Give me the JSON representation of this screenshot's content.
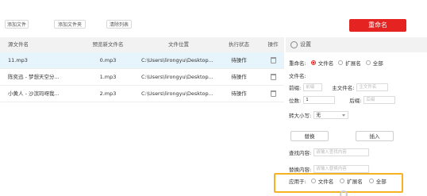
{
  "toolbar": {
    "add_file": "添加文件",
    "add_folder": "添加文件夹",
    "clear_list": "清除列表",
    "rename": "重命名"
  },
  "table": {
    "headers": [
      "源文件名",
      "预览新文件名",
      "文件位置",
      "执行状态",
      "操作"
    ],
    "rows": [
      {
        "source": "11.mp3",
        "preview": "0.mp3",
        "location": "C:\\Users\\lirongyu\\Desktop...",
        "status": "待操作"
      },
      {
        "source": "陈奕迅 - 梦想天空分...",
        "preview": "1.mp3",
        "location": "C:\\Users\\lirongyu\\Desktop...",
        "status": "待操作"
      },
      {
        "source": "小黄人 - 沙滨玛呀我...",
        "preview": "2.mp3",
        "location": "C:\\Users\\lirongyu\\Desktop...",
        "status": "待操作"
      }
    ]
  },
  "panel": {
    "title": "设置",
    "rename_label": "重命名:",
    "opt_filename": "文件名",
    "opt_ext": "扩展名",
    "opt_all": "全部",
    "filename_label": "文件名:",
    "prefix_label": "前缀:",
    "prefix_placeholder": "前缀",
    "main_label": "主文件名:",
    "main_placeholder": "主文件名",
    "digits_label": "位数:",
    "digits_value": "1",
    "suffix_label": "后缀:",
    "suffix_placeholder": "后缀",
    "case_label": "转大小写:",
    "case_value": "无",
    "replace_btn": "替换",
    "insert_btn": "插入",
    "find_label": "查找内容:",
    "find_placeholder": "请输入查找内容",
    "replace_label": "替换内容:",
    "replace_placeholder": "请输入替换内容",
    "apply_label": "应用于:",
    "apply_filename": "文件名",
    "apply_ext": "扩展名",
    "apply_all": "全部"
  },
  "colors": {
    "accent": "#e52421",
    "highlight": "#f5b324",
    "selected_row": "#e6f4fc"
  }
}
